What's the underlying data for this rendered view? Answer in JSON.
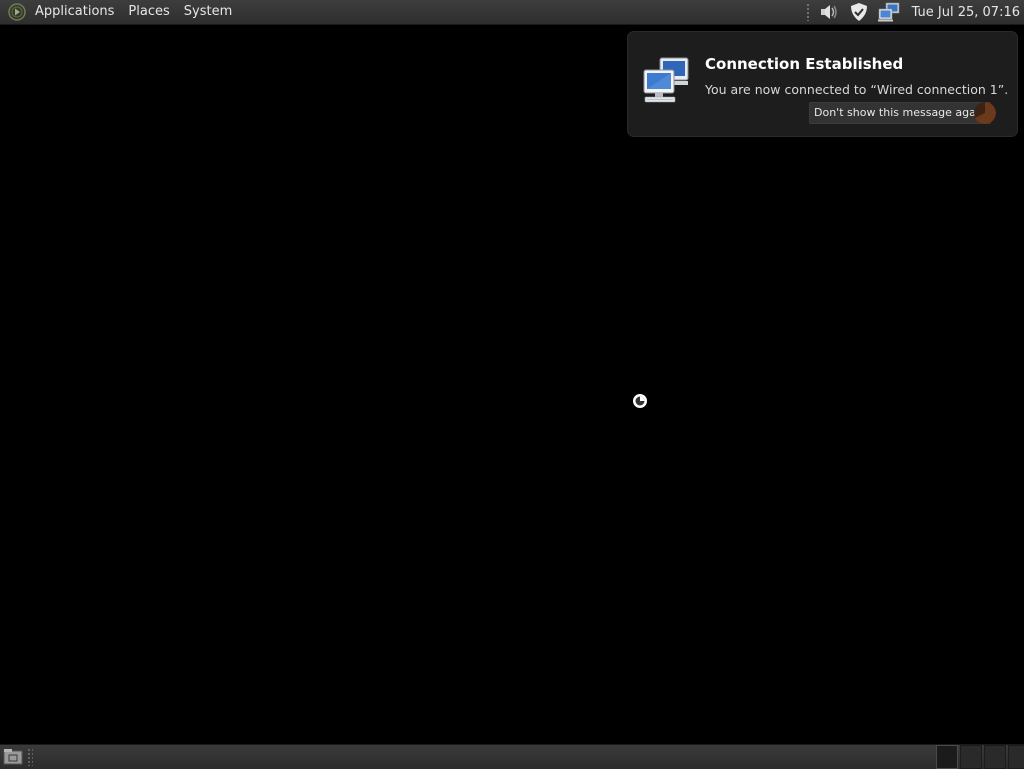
{
  "top_panel": {
    "menus": [
      {
        "label": "Applications",
        "name": "applications-menu"
      },
      {
        "label": "Places",
        "name": "places-menu"
      },
      {
        "label": "System",
        "name": "system-menu"
      }
    ],
    "clock": "Tue Jul 25, 07:16",
    "tray_icons": [
      "volume-icon",
      "shield-icon",
      "network-icon"
    ]
  },
  "notification": {
    "title": "Connection Established",
    "body": "You are now connected to “Wired connection 1”.",
    "action_label": "Don't show this message again",
    "icon": "network-computers-icon"
  },
  "bottom_panel": {
    "show_desktop_icon": "show-desktop-icon",
    "workspace_count": 4,
    "active_workspace": 1
  },
  "colors": {
    "panel_bg": "#333333",
    "desktop_bg": "#000000",
    "notification_bg": "#1d1d1d",
    "timer_accent": "#6b3a1a"
  }
}
